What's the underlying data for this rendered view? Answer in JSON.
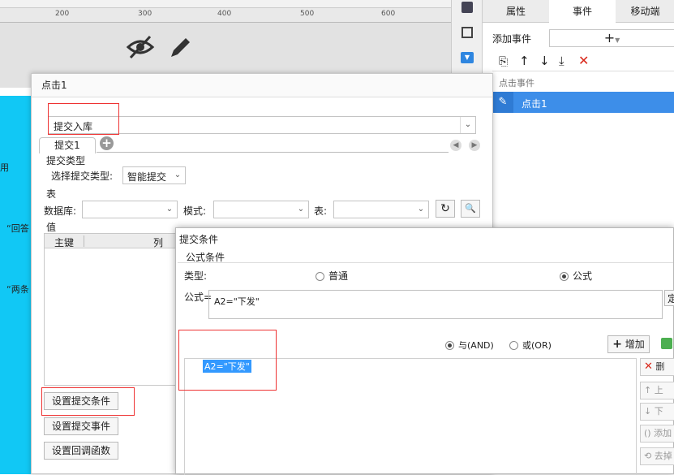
{
  "ruler": {
    "ticks": [
      "200",
      "300",
      "400",
      "500",
      "600"
    ]
  },
  "grid_labels": [
    "用",
    "“回答",
    "“两条"
  ],
  "right_panel": {
    "tabs": [
      "属性",
      "事件",
      "移动端"
    ],
    "add_event_label": "添加事件",
    "event_list_header": "点击事件",
    "event_item": "点击1"
  },
  "dialog1": {
    "title": "点击1",
    "submit_type_value": "提交入库",
    "tab_label": "提交1",
    "section_submit_type": "提交类型",
    "select_submit_type_label": "选择提交类型:",
    "select_submit_type_value": "智能提交",
    "section_table": "表",
    "database_label": "数据库:",
    "mode_label": "模式:",
    "table_label": "表:",
    "section_value": "值",
    "columns": [
      "主键",
      "列"
    ],
    "buttons": [
      "设置提交条件",
      "设置提交事件",
      "设置回调函数"
    ]
  },
  "dialog2": {
    "title": "提交条件",
    "group_label": "公式条件",
    "type_label": "类型:",
    "type_options": [
      "普通",
      "公式"
    ],
    "type_selected": "公式",
    "formula_label": "公式=",
    "formula_value": "A2=\"下发\"",
    "define_btn": "定",
    "logic_options": [
      "与(AND)",
      "或(OR)"
    ],
    "logic_selected": "与(AND)",
    "add_btn": "增加",
    "condition_item": "A2=\"下发\"",
    "side_buttons": [
      "删",
      "上",
      "下",
      "添加",
      "去掉"
    ]
  },
  "colors": {
    "accent": "#3d8ee9",
    "highlight": "#3399ff",
    "grid": "#11c8f5",
    "red_box": "#ee3333",
    "delete_red": "#d9271a"
  }
}
